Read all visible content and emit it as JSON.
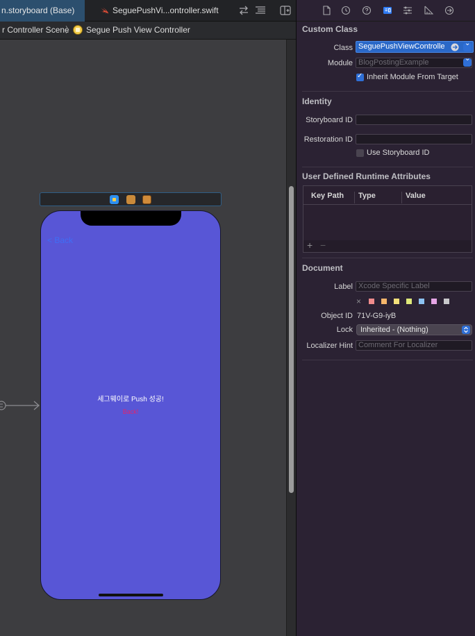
{
  "tabs": {
    "storyboard": "n.storyboard (Base)",
    "swift_file": "SeguePushVi...ontroller.swift"
  },
  "jumpbar": {
    "scene": "r Controller Scene",
    "view_controller": "Segue Push View Controller"
  },
  "phone": {
    "nav_back": "< Back",
    "success_label": "세그웨이로 Push 성공!",
    "back_button": "Back!"
  },
  "inspector": {
    "custom_class": {
      "title": "Custom Class",
      "class_label": "Class",
      "class_value": "SeguePushViewControlle",
      "module_label": "Module",
      "module_placeholder": "BlogPostingExample",
      "inherit_label": "Inherit Module From Target",
      "inherit_checked": true
    },
    "identity": {
      "title": "Identity",
      "storyboard_id_label": "Storyboard ID",
      "restoration_id_label": "Restoration ID",
      "use_storyboard_id_label": "Use Storyboard ID",
      "use_storyboard_id_checked": false
    },
    "runtime_attributes": {
      "title": "User Defined Runtime Attributes",
      "columns": [
        "Key Path",
        "Type",
        "Value"
      ],
      "add": "+",
      "remove": "−"
    },
    "document": {
      "title": "Document",
      "label_label": "Label",
      "label_placeholder": "Xcode Specific Label",
      "swatch_clear": "×",
      "swatch_colors": [
        "#f08c8c",
        "#f6b66b",
        "#f3e07a",
        "#dfe97a",
        "#8cc3f2",
        "#e6a6e6",
        "#c9c9cc"
      ],
      "object_id_label": "Object ID",
      "object_id": "71V-G9-iyB",
      "lock_label": "Lock",
      "lock_value": "Inherited - (Nothing)",
      "localizer_label": "Localizer Hint",
      "localizer_placeholder": "Comment For Localizer"
    }
  },
  "colors": {
    "view_background": "#5856d6",
    "accent": "#2f6fd6",
    "back_button": "#e0246e"
  }
}
